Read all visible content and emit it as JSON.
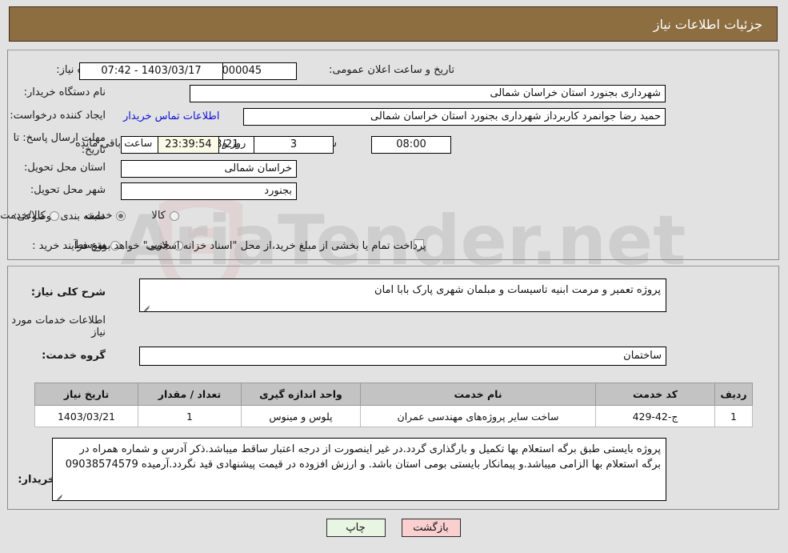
{
  "header": {
    "title": "جزئیات اطلاعات نیاز"
  },
  "summary": {
    "need_number_label": "شماره نیاز:",
    "need_number_value": "1103005297000045",
    "announce_datetime_label": "تاریخ و ساعت اعلان عمومی:",
    "announce_datetime_value": "1403/03/17 - 07:42",
    "buyer_org_label": "نام دستگاه خریدار:",
    "buyer_org_value": "شهرداری بجنورد استان خراسان شمالی",
    "requester_label": "ایجاد کننده درخواست:",
    "requester_value": "حمید رضا جوانمرد کاربرداز شهرداری بجنورد استان خراسان شمالی",
    "buyer_contact_link": "اطلاعات تماس خریدار",
    "deadline_label": "مهلت ارسال پاسخ: تا تاریخ:",
    "deadline_date": "1403/03/21",
    "deadline_time_label": "ساعت",
    "deadline_time": "08:00",
    "remaining_days": "3",
    "remaining_days_label": "روز و",
    "remaining_clock": "23:39:54",
    "remaining_suffix_label": "ساعت باقی مانده",
    "province_label": "استان محل تحویل:",
    "province_value": "خراسان شمالی",
    "city_label": "شهر محل تحویل:",
    "city_value": "بجنورد",
    "category_label": "طبقه بندی موضوعی:",
    "category_options": [
      {
        "label": "کالا",
        "selected": false
      },
      {
        "label": "خدمت",
        "selected": true
      },
      {
        "label": "کالا/خدمت",
        "selected": false
      }
    ],
    "process_label": "نوع فرآیند خرید :",
    "process_options": [
      {
        "label": "جزیی",
        "selected": false
      },
      {
        "label": "متوسط",
        "selected": false
      }
    ],
    "treasury_checkbox_checked": false,
    "treasury_note": "پرداخت تمام یا بخشی از مبلغ خرید،از محل \"اسناد خزانه اسلامی\" خواهد بود."
  },
  "description": {
    "general_label": "شرح کلی نیاز:",
    "general_value": "پروژه تعمیر و مرمت ابنیه تاسیسات و مبلمان شهری پارک بابا امان",
    "services_heading": "اطلاعات خدمات مورد نیاز",
    "service_group_label": "گروه خدمت:",
    "service_group_value": "ساختمان"
  },
  "table": {
    "headers": [
      "ردیف",
      "کد خدمت",
      "نام خدمت",
      "واحد اندازه گیری",
      "تعداد / مقدار",
      "تاریخ نیاز"
    ],
    "rows": [
      {
        "index": "1",
        "service_code": "ج-42-429",
        "service_name": "ساخت سایر پروژه‌های مهندسی عمران",
        "unit": "پلوس و مینوس",
        "quantity": "1",
        "need_date": "1403/03/21"
      }
    ]
  },
  "buyer_notes": {
    "label": "توضیحات خریدار:",
    "value": "پروژه بایستی طبق برگه استعلام بها  تکمیل و بارگذاری گردد.در غیر اینصورت از درجه اعتبار ساقط میباشد.ذکر آدرس و شماره همراه در برگه استعلام بها الزامی میباشد.و پیمانکار بایستی بومی استان باشد. و ارزش افزوده در قیمت پیشنهادی قید نگردد.آرمیده 09038574579"
  },
  "footer": {
    "print_label": "چاپ",
    "back_label": "بازگشت"
  },
  "watermark": {
    "text": "AriaTender.net"
  },
  "colors": {
    "header_bg": "#8d6e41",
    "page_bg": "#e2e2e2",
    "link": "#1111d8",
    "table_header_bg": "#c3c3c3",
    "print_btn_bg": "#e8f5e2",
    "back_btn_bg": "#f9cfcf",
    "countdown_bg": "#fbfbe8"
  }
}
